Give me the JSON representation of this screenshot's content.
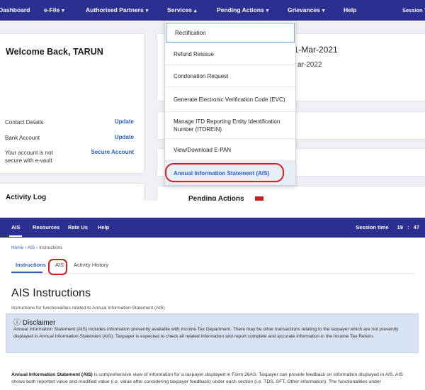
{
  "portal_nav": {
    "items": [
      {
        "label": "Dashboard",
        "caret": false
      },
      {
        "label": "e-File",
        "caret": true
      },
      {
        "label": "Authorised Partners",
        "caret": true
      },
      {
        "label": "Services",
        "caret": true
      },
      {
        "label": "Pending Actions",
        "caret": true
      },
      {
        "label": "Grievances",
        "caret": true
      },
      {
        "label": "Help",
        "caret": false
      },
      {
        "label": "Session T",
        "caret": false
      }
    ],
    "caret_down": "▾",
    "caret_up": "▴"
  },
  "welcome_card": {
    "greeting": "Welcome Back, TARUN",
    "rows": [
      {
        "label": "Contact Details",
        "link": "Update"
      },
      {
        "label": "Bank Account",
        "link": "Update"
      },
      {
        "label": "Your account is not secure with e-vault",
        "link": "Secure Account"
      }
    ]
  },
  "activity_log": "Activity Log",
  "right_card": {
    "date_fragment": "31-Mar-2021",
    "date_fragment_2": "ar-2022",
    "pending_actions": "Pending Actions"
  },
  "services_dropdown": {
    "items": [
      "Rectification",
      "Refund Reissue",
      "Condonation Request",
      "Generate Electronic Verification Code (EVC)",
      "Manage ITD Reporting Entity Identification Number (ITDREIN)",
      "View/Download E-PAN",
      "Annual Information Statement (AIS)"
    ]
  },
  "ais_nav": {
    "items": [
      "AIS",
      "Resources",
      "Rate Us",
      "Help"
    ],
    "session_label": "Session time",
    "session_min": "19",
    "session_sep": ":",
    "session_sec": "47"
  },
  "breadcrumb": {
    "home": "Home",
    "ais": "AIS",
    "current": "Instructions",
    "sep": "›"
  },
  "tabs": [
    "Instructions",
    "AIS",
    "Activity History"
  ],
  "page_title": "AIS Instructions",
  "page_subtitle": "Instructions for functionalities related to Annual Information Statement (AIS)",
  "disclaimer": {
    "icon": "ⓘ",
    "title": "Disclaimer",
    "body": "Annual Information Statement (AIS) includes information presently available with Income Tax Department. There may be other transactions relating to the taxpayer which are not presently displayed in Annual Information Statement (AIS). Taxpayer is expected to check all related information and report complete and accurate information in the Income Tax Return."
  },
  "info_para": {
    "bold": "Annual Information Statement (AIS)",
    "text": " is comprehensive view of information for a taxpayer displayed in Form 26AS. Taxpayer can provide feedback on information displayed in AIS. AIS shows both reported value and modified value (i.e. value after considering taxpayer feedback) under each section (i.e. TDS, SFT, Other information). The functionalities under"
  },
  "colors": {
    "nav_bg": "#2b2f8f",
    "accent": "#2a5ec5",
    "highlight_ring": "#d21f1f",
    "disclaimer_bg": "#d7e3f2"
  }
}
